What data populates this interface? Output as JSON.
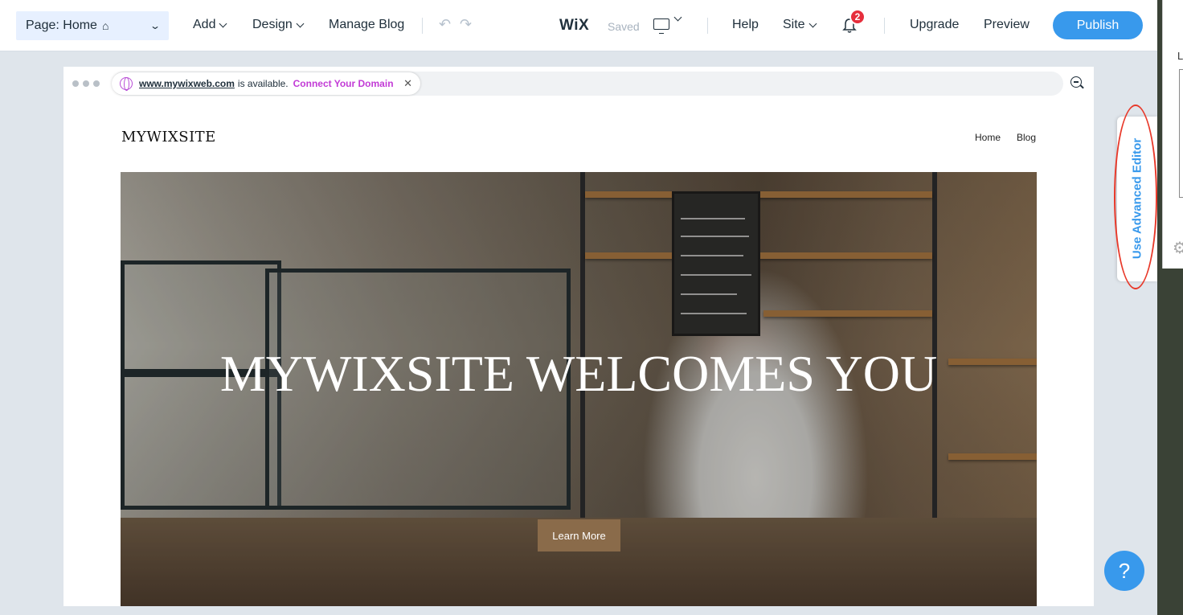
{
  "topbar": {
    "page_label": "Page: Home",
    "menu": [
      "Add",
      "Design",
      "Manage Blog"
    ],
    "logo": "WiX",
    "saved": "Saved",
    "right_menu": [
      "Help",
      "Site"
    ],
    "notifications": "2",
    "upgrade": "Upgrade",
    "preview": "Preview",
    "publish": "Publish"
  },
  "browser": {
    "url": "www.mywixweb.com",
    "available_text": "is available.",
    "connect_domain": "Connect Your Domain"
  },
  "site": {
    "title": "MYWIXSITE",
    "nav": [
      "Home",
      "Blog"
    ],
    "hero_title": "MYWIXSITE WELCOMES YOU",
    "cta": "Learn More"
  },
  "side": {
    "advanced_editor": "Use Advanced Editor",
    "panel_letter": "L",
    "help": "?"
  },
  "colors": {
    "accent": "#3899ec",
    "badge": "#e62e3c",
    "connect": "#c23bd6",
    "cta": "#8a6b4a"
  }
}
